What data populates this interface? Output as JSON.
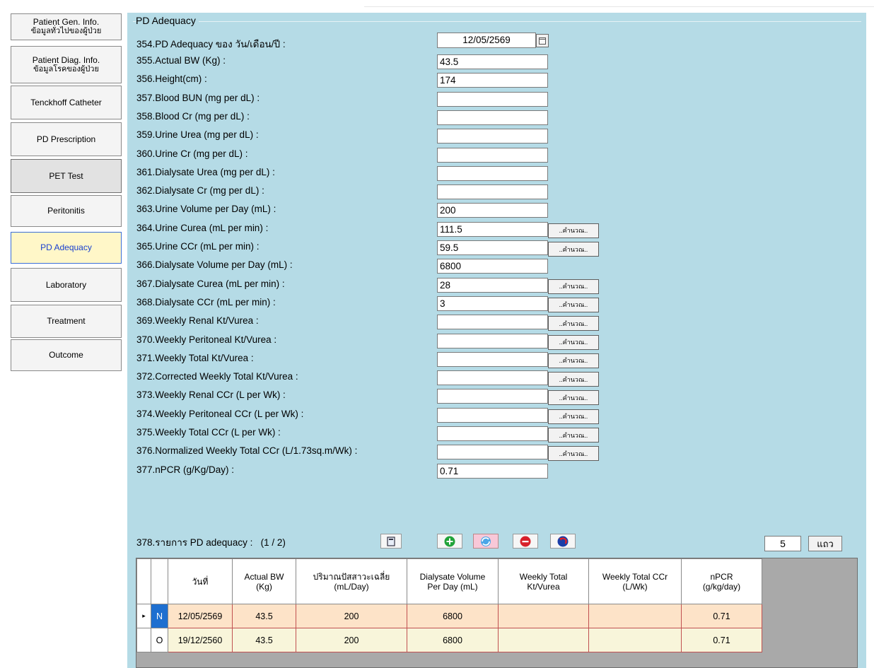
{
  "sidebar": {
    "items": [
      {
        "line1": "Patient Gen. Info.",
        "line2": "ข้อมูลทั่วไปของผู้ป่วย"
      },
      {
        "line1": "Patient Diag. Info.",
        "line2": "ข้อมูลโรคของผู้ป่วย"
      },
      {
        "line1": "Tenckhoff Catheter"
      },
      {
        "line1": "PD Prescription"
      },
      {
        "line1": "PET Test"
      },
      {
        "line1": "Peritonitis"
      },
      {
        "line1": "PD Adequacy"
      },
      {
        "line1": "Laboratory"
      },
      {
        "line1": "Treatment"
      },
      {
        "line1": "Outcome"
      }
    ],
    "active_index": 6
  },
  "panel": {
    "title": "PD Adequacy",
    "date_label": "354.PD Adequacy ของ วัน/เดือน/ปี :",
    "date_value": "12/05/2569",
    "calc_label": "..คำนวณ..",
    "fields": [
      {
        "label": "355.Actual BW (Kg) :",
        "value": "43.5"
      },
      {
        "label": "356.Height(cm) :",
        "value": "174"
      },
      {
        "label": "357.Blood BUN (mg per dL) :",
        "value": ""
      },
      {
        "label": "358.Blood Cr (mg per dL) :",
        "value": ""
      },
      {
        "label": "359.Urine Urea (mg per dL) :",
        "value": ""
      },
      {
        "label": "360.Urine Cr (mg per dL) :",
        "value": ""
      },
      {
        "label": "361.Dialysate Urea (mg per dL) :",
        "value": ""
      },
      {
        "label": "362.Dialysate Cr (mg per dL) :",
        "value": ""
      },
      {
        "label": "363.Urine Volume per Day (mL) :",
        "value": "200"
      },
      {
        "label": "364.Urine Curea (mL per min) :",
        "value": "111.5"
      },
      {
        "label": "365.Urine CCr (mL per min) :",
        "value": "59.5"
      },
      {
        "label": "366.Dialysate Volume per Day (mL) :",
        "value": "6800"
      },
      {
        "label": "367.Dialysate Curea (mL per min) :",
        "value": "28"
      },
      {
        "label": "368.Dialysate CCr (mL per min) :",
        "value": "3"
      },
      {
        "label": "369.Weekly Renal Kt/Vurea :",
        "value": ""
      },
      {
        "label": "370.Weekly Peritoneal Kt/Vurea :",
        "value": ""
      },
      {
        "label": "371.Weekly Total Kt/Vurea :",
        "value": ""
      },
      {
        "label": "372.Corrected Weekly Total Kt/Vurea :",
        "value": ""
      },
      {
        "label": "373.Weekly Renal CCr (L per Wk) :",
        "value": ""
      },
      {
        "label": "374.Weekly Peritoneal CCr (L per Wk) :",
        "value": ""
      },
      {
        "label": "375.Weekly Total CCr (L per Wk) :",
        "value": ""
      },
      {
        "label": "376.Normalized Weekly Total CCr (L/1.73sq.m/Wk) :",
        "value": ""
      },
      {
        "label": "377.nPCR (g/Kg/Day) :",
        "value": "0.71"
      }
    ],
    "list_label": "378.รายการ PD adequacy :",
    "list_pager": "(1 / 2)",
    "rows_value": "5",
    "rows_unit": "แถว"
  },
  "grid": {
    "headers": [
      "วันที่",
      "Actual BW\n(Kg)",
      "ปริมาณปัสสาวะเฉลี่ย\n(mL/Day)",
      "Dialysate Volume\nPer Day (mL)",
      "Weekly Total\nKt/Vurea",
      "Weekly Total CCr\n(L/Wk)",
      "nPCR\n(g/kg/day)"
    ],
    "rows": [
      {
        "indicator": "▸",
        "status": "N",
        "cells": [
          "12/05/2569",
          "43.5",
          "200",
          "6800",
          "",
          "",
          "0.71"
        ]
      },
      {
        "indicator": "",
        "status": "O",
        "cells": [
          "19/12/2560",
          "43.5",
          "200",
          "6800",
          "",
          "",
          "0.71"
        ]
      }
    ]
  },
  "icons": {
    "calendar": "calendar-icon",
    "report": "report-icon",
    "add": "add-icon",
    "refresh": "refresh-icon",
    "delete": "delete-icon",
    "undo": "undo-icon"
  },
  "colors": {
    "panel_bg": "#b5dbe6",
    "active_nav_bg": "#fff7c8",
    "active_nav_text": "#1a40d0",
    "row_new_bg": "#fde3c8",
    "row_old_bg": "#f8f5da",
    "status_new_bg": "#1e6fd0"
  }
}
